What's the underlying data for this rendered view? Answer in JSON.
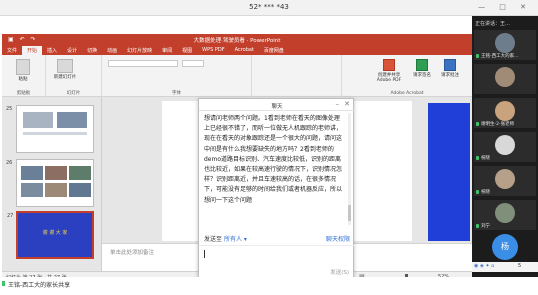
{
  "meeting": {
    "title": "52* *** *43",
    "window_buttons": "— □ ✕"
  },
  "ppt": {
    "doc_title": "大数据处理·驾驶员看 · PowerPoint",
    "quick_access": "▣ ↶ ↷",
    "tabs": [
      "文件",
      "开始",
      "插入",
      "设计",
      "切换",
      "动画",
      "幻灯片放映",
      "审阅",
      "视图",
      "WPS PDF",
      "Acrobat",
      "百度网盘"
    ],
    "active_tab": "开始",
    "ribbon": {
      "groups": [
        "剪贴板",
        "幻灯片",
        "字体",
        "Adobe Acrobat"
      ],
      "buttons": [
        "粘贴",
        "新建幻灯片",
        "创建并共享Adobe PDF",
        "请求签名",
        "请求批注"
      ]
    },
    "thumbs": [
      {
        "num": "25"
      },
      {
        "num": "26"
      },
      {
        "num": "27",
        "text": "谢 谢 大 家"
      }
    ],
    "notes_placeholder": "单击此处添加备注",
    "status_left": "幻灯片 第 27 张，共 27 张",
    "zoom": "52%"
  },
  "chat": {
    "title": "聊天",
    "message": "想请问老师两个问题。1看到老师在看天的图像处理上已经很不错了，而听一位做无人机跟踪的老师讲，现在在看天的对象跟踪还是一个很大的问题，请问这中间是有什么我想要缺失的地方吗？2看到老师的demo道路目标识别、汽车速度比较低，识别的距离也比较近，如果在较高速行驶的情况下，识别情况怎样？识别距离近，并且车速较高的话，在很多情况下，可能没有足够的时间给我们或者机器反应，所以想问一下这个问题",
    "send_to_label": "发送至",
    "send_to_value": "所有人 ▾",
    "permission": "聊天权限",
    "send_button": "发送(S)"
  },
  "panel": {
    "title": "正在讲话：王…",
    "participants": [
      {
        "name": "王铭-西工大的家…",
        "mic": true
      },
      {
        "name": ""
      },
      {
        "name": "谢明生-2-张老师",
        "mic": true
      },
      {
        "name": "祝晓",
        "mic": true
      },
      {
        "name": "祝晓",
        "mic": true
      },
      {
        "name": "刘宁",
        "mic": true
      }
    ],
    "self_avatar": "杨"
  },
  "bottom_speaker": "王铭-西工大的家长共享",
  "tray_time": "5"
}
